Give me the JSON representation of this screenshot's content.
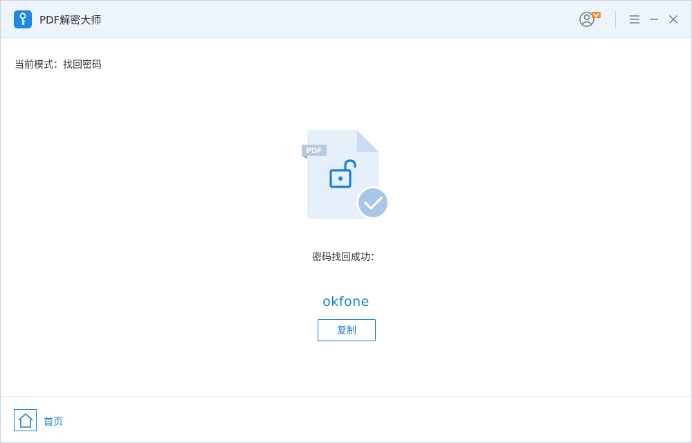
{
  "window": {
    "title": "PDF解密大师",
    "app_icon": "key-icon",
    "controls": [
      "user-vip-icon",
      "menu-icon",
      "minimize-icon",
      "close-icon"
    ]
  },
  "mode": {
    "label": "当前模式：找回密码"
  },
  "result": {
    "file_badge": "PDF",
    "illustration_icon": "unlocked-pdf-check-icon",
    "success_text": "密码找回成功：",
    "password": "okfone",
    "copy_label": "复制"
  },
  "footer": {
    "home_label": "首页",
    "home_icon": "home-icon"
  },
  "colors": {
    "accent": "#1a7fd0",
    "titlebar_bg": "#eef4fb",
    "vip_badge": "#f08c2a",
    "file_bg": "#e6f0fb",
    "check_circle": "#a9c6e6"
  }
}
